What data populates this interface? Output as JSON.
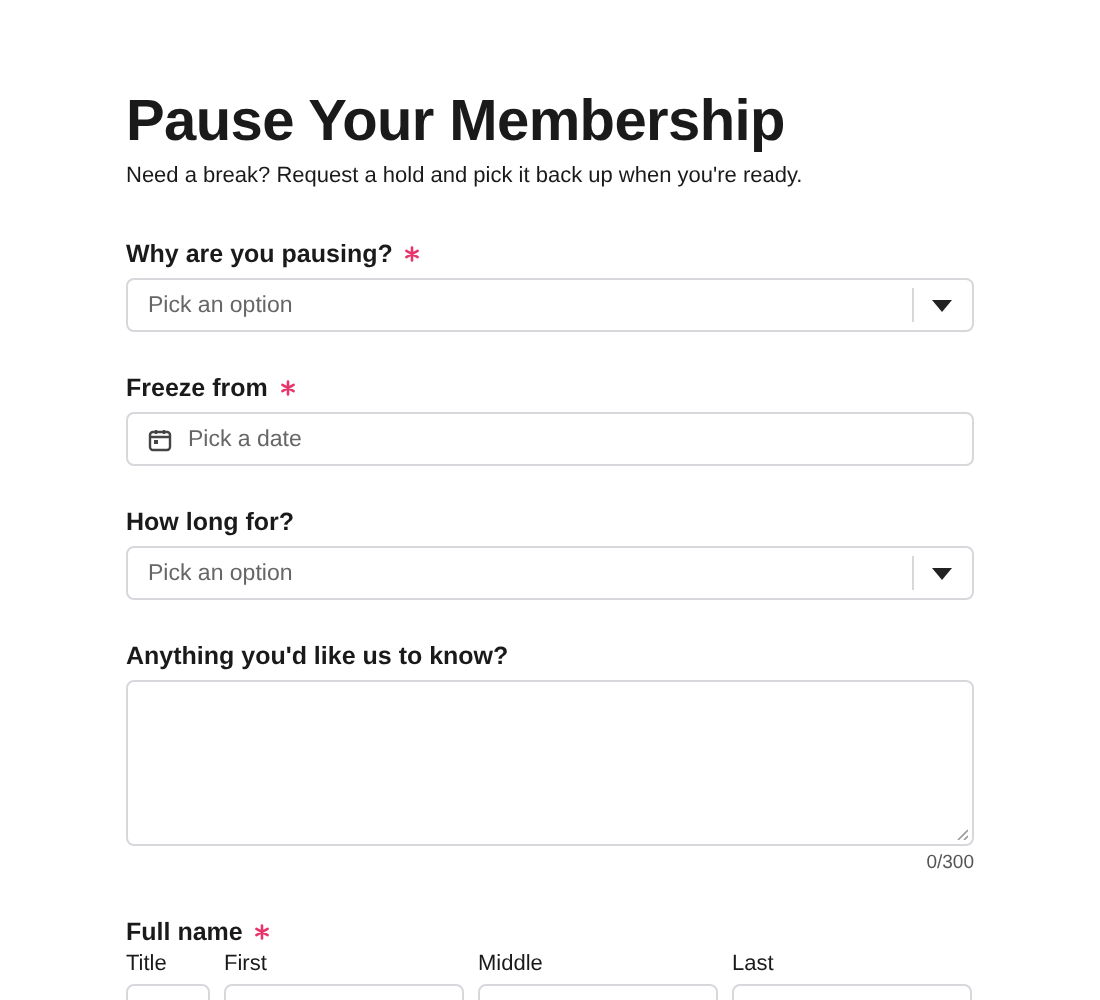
{
  "title": "Pause Your Membership",
  "subtitle": "Need a break? Request a hold and pick it back up when you're ready.",
  "fields": [
    {
      "kind": "select",
      "label": "Why are you pausing?",
      "required": true,
      "placeholder": "Pick an option"
    },
    {
      "kind": "date",
      "label": "Freeze from",
      "required": true,
      "placeholder": "Pick a date"
    },
    {
      "kind": "select",
      "label": "How long for?",
      "required": false,
      "placeholder": "Pick an option"
    },
    {
      "kind": "textarea",
      "label": "Anything you'd like us to know?",
      "required": false,
      "counter": "0/300"
    },
    {
      "kind": "name",
      "label": "Full name",
      "required": true,
      "parts": [
        "Title",
        "First",
        "Middle",
        "Last"
      ]
    }
  ]
}
